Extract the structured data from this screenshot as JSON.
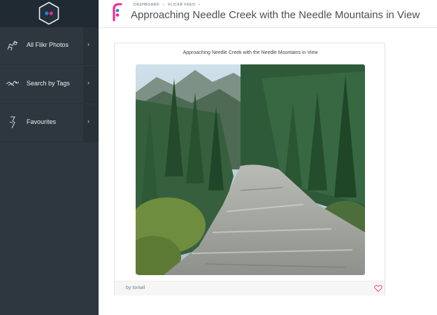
{
  "sidebar": {
    "logo_icon": "flickr-hexagon-icon",
    "items": [
      {
        "label": "All Flikr Photos",
        "icon": "camera-icon"
      },
      {
        "label": "Search by Tags",
        "icon": "tags-icon"
      },
      {
        "label": "Favourites",
        "icon": "bookmark-icon"
      }
    ],
    "chevron": "›"
  },
  "header": {
    "breadcrumb": [
      "DASHBOARD",
      "FLICKR FEED"
    ],
    "separator": "›",
    "title": "Approaching Needle Creek with the Needle Mountains in View",
    "logo_icon": "flickr-f-icon"
  },
  "photo_card": {
    "title": "Approaching Needle Creek with the Needle Mountains in View",
    "author_prefix": "by",
    "author": "toriwil",
    "favourite_icon": "heart-icon",
    "image": "mountain-creek-photo"
  },
  "colors": {
    "sidebar_bg": "#2e3740",
    "flickr_blue": "#2a7de1",
    "flickr_pink": "#ff1f8a",
    "heart": "#f0506e"
  }
}
